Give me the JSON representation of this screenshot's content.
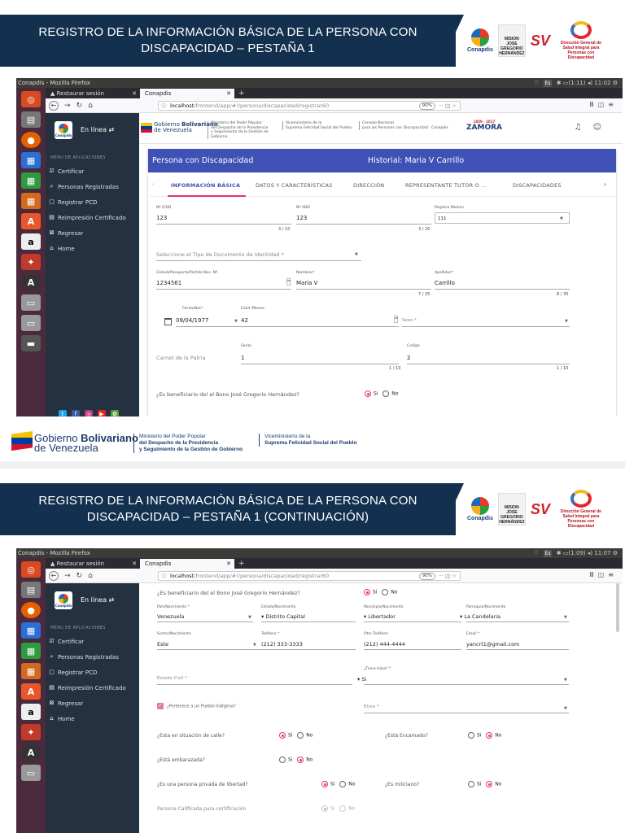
{
  "slide1": {
    "title": "REGISTRO DE LA INFORMACIÓN BÁSICA DE LA PERSONA CON DISCAPACIDAD – PESTAÑA 1"
  },
  "slide2": {
    "title": "REGISTRO DE LA INFORMACIÓN BÁSICA DE LA PERSONA CON DISCAPACIDAD –  PESTAÑA 1 (CONTINUACIÓN)"
  },
  "logos": {
    "conapdis": "Conapdis",
    "hernandez": "MISION JOSE GREGORIO HERNÁNDEZ",
    "sv": "SV",
    "dg": "Dirección General de Salud Integral para Personas con Discapacidad"
  },
  "window": {
    "title": "Conapdis - Mozilla Firefox",
    "time1": "11:02",
    "time2": "11:07",
    "battery1": "(1:11)",
    "battery2": "(1:09)",
    "kb": "Es"
  },
  "browser": {
    "tab1": "Restaurar sesión",
    "tab2": "Conapdis",
    "url_host": "localhost",
    "url_path": "/frontend/app/#!/persona/discapacidad/registrar60",
    "zoom": "90%"
  },
  "sidebar": {
    "online": "En línea",
    "menu_title": "MENU DE APLICACIONES",
    "items": [
      "Certificar",
      "Personas Registradas",
      "Registrar PCD",
      "Reimpresión Certificado",
      "Regresar",
      "Home"
    ]
  },
  "gob": {
    "name1": "Gobierno",
    "name2": "Bolivariano",
    "name3": "de Venezuela",
    "min1": "Ministerio del Poder Popular",
    "min2": "del Despacho de la Presidencia",
    "min3": "y Seguimiento de la Gestión de Gobierno",
    "vice1": "Viceministerio de la",
    "vice2": "Suprema Felicidad Social del Pueblo",
    "cons1": "Consejo Nacional",
    "cons2": "para las Personas con Discapacidad · Conapdis"
  },
  "zamora": {
    "title": "ZAMORA",
    "years": "1859 · 2017"
  },
  "card": {
    "title": "Persona con Discapacidad",
    "historial": "Historial: Maria V Carrillo",
    "tabs": [
      "INFORMACIÓN BÁSICA",
      "DATOS Y CARACTERÍSTICAS",
      "DIRECCIÓN",
      "REPRESENTANTE TUTOR O ...",
      "DISCAPACIDADES"
    ]
  },
  "form1": {
    "ncdd_label": "Nº ICDD",
    "ncdd_value": "123",
    "ncdd_count": "3 / 10",
    "abis_label": "Nº ABIS",
    "abis_value": "123",
    "abis_count": "3 / 20",
    "reg_label": "Registro Medico",
    "reg_value": "111",
    "tipo_doc_placeholder": "Seleccione el Tipo de Documento de Identidad *",
    "cedula_label": "Cédula/Pasaporte/Partida Nac. Nº",
    "cedula_value": "1234561",
    "nombres_label": "Nombres*",
    "nombres_value": "Maria V",
    "nombres_count": "7 / 35",
    "apellidos_label": "Apellidos*",
    "apellidos_value": "Carrillo",
    "apellidos_count": "8 / 35",
    "fecha_label": "Fecha/Nac*",
    "fecha_value": "09/04/1977",
    "edad_label": "Edad /Meses:",
    "edad_value": "42",
    "sexo_placeholder": "Sexo *",
    "carnet_label": "Carnet de la Patria",
    "serial_label": "Serial",
    "serial_value": "1",
    "serial_count": "1 / 10",
    "codigo_label": "Codigo",
    "codigo_value": "2",
    "codigo_count": "1 / 10",
    "bono_q": "¿Es beneficiario del el Bono José Gregorio Hernández?",
    "si": "Si",
    "no": "No"
  },
  "form2": {
    "bono_q": "¿Es beneficiario del el Bono José Gregorio Hernández?",
    "pais_label": "País/Nacimiento *",
    "pais_value": "Venezuela",
    "estado_label": "Estado/Nacimiento",
    "estado_value": "Distrito Capital",
    "mun_label": "Municipio/Nacimiento",
    "mun_value": "Libertador",
    "parr_label": "Parroquia/Nacimiento",
    "parr_value": "La Candelaria",
    "sector_label": "Sector/Nacimiento",
    "sector_value": "Este",
    "tel_label": "Teléfono *",
    "tel_value": "(212) 333-3333",
    "otro_label": "Otro Teléfono",
    "otro_value": "(212) 444-4444",
    "email_label": "Email *",
    "email_value": "yancrt1@gmail.com",
    "civil_placeholder": "Estado Civil *",
    "hijos_label": "¿Tiene Hijos? *",
    "hijos_value": "Si",
    "indigena": "¿Pertenece a un Pueblo Indígena?",
    "etnia_placeholder": "Etnia *",
    "calle_q": "¿Esta en situación de calle?",
    "encamado_q": "¿Está Encamado?",
    "embarazada_q": "¿Está embarazada?",
    "privada_q": "¿Es una persona privada de libertad?",
    "miliciano_q": "¿Es miliciano?",
    "calificada_q": "Persona Calificada para certificación",
    "si": "Si",
    "no": "No"
  },
  "colors": {
    "banner": "#13314f",
    "primary": "#3f51b5",
    "accent": "#e8336a",
    "sidebar": "#233140",
    "launcher": "#4a2a3c"
  }
}
